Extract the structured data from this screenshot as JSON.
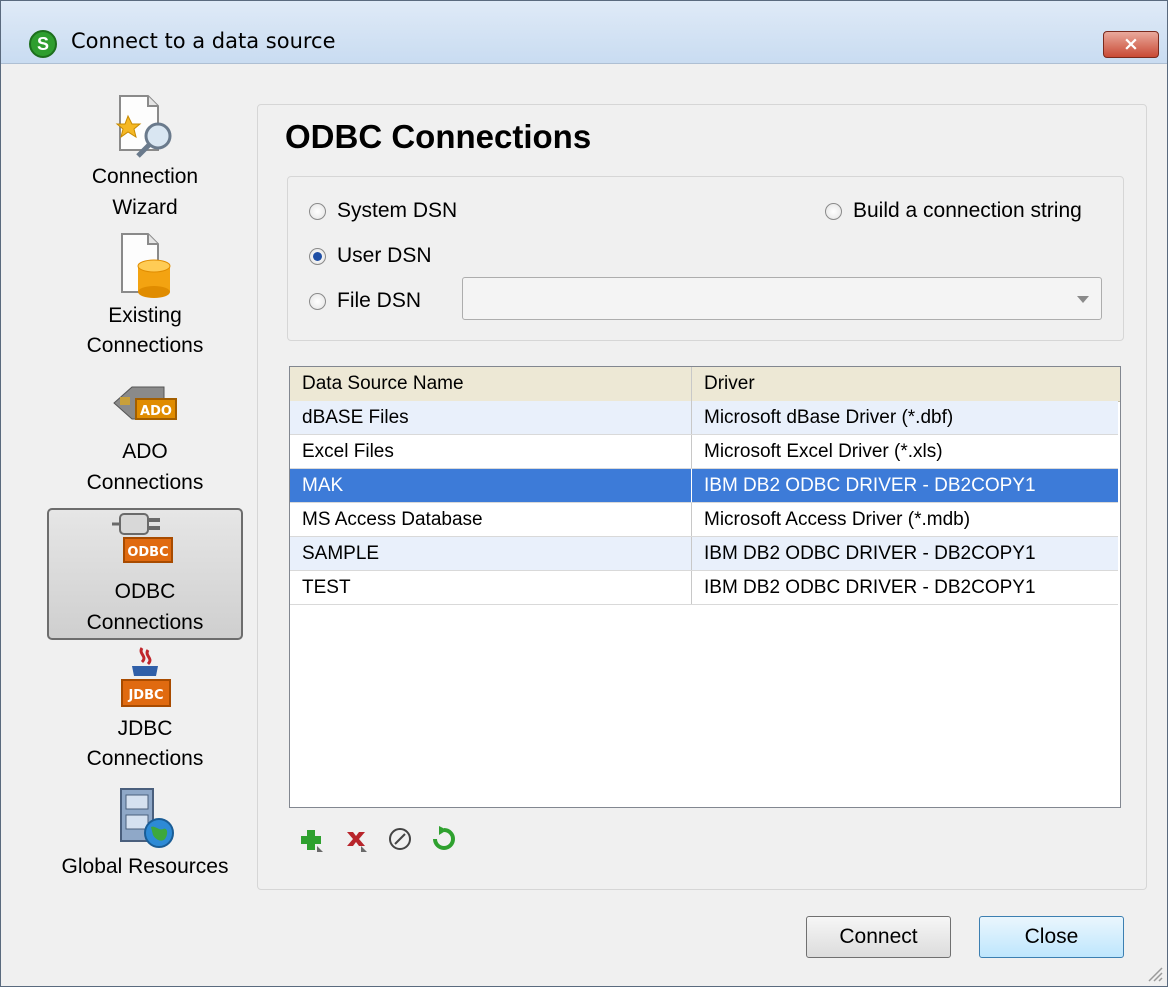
{
  "window": {
    "title": "Connect to a data source",
    "close_label": "×"
  },
  "sidebar": {
    "items": [
      {
        "label_line1": "Connection",
        "label_line2": "Wizard"
      },
      {
        "label_line1": "Existing",
        "label_line2": "Connections"
      },
      {
        "label_line1": "ADO",
        "label_line2": "Connections",
        "icon_text": "ADO"
      },
      {
        "label_line1": "ODBC",
        "label_line2": "Connections",
        "icon_text": "ODBC",
        "active": true
      },
      {
        "label_line1": "JDBC",
        "label_line2": "Connections",
        "icon_text": "JDBC"
      },
      {
        "label_line1": "Global Resources"
      }
    ]
  },
  "panel": {
    "title": "ODBC Connections",
    "radios": {
      "system_dsn": "System DSN",
      "user_dsn": "User DSN",
      "file_dsn": "File DSN",
      "build_string": "Build a connection string",
      "selected": "user_dsn"
    },
    "file_dsn_value": ""
  },
  "table": {
    "columns": [
      "Data Source Name",
      "Driver"
    ],
    "rows": [
      [
        "dBASE Files",
        "Microsoft dBase Driver (*.dbf)"
      ],
      [
        "Excel Files",
        "Microsoft Excel Driver (*.xls)"
      ],
      [
        "MAK",
        "IBM DB2 ODBC DRIVER - DB2COPY1"
      ],
      [
        "MS Access Database",
        "Microsoft Access Driver (*.mdb)"
      ],
      [
        "SAMPLE",
        "IBM DB2 ODBC DRIVER - DB2COPY1"
      ],
      [
        "TEST",
        "IBM DB2 ODBC DRIVER - DB2COPY1"
      ]
    ],
    "selected_row": 2
  },
  "toolbar": {
    "icons": [
      "add-icon",
      "delete-icon",
      "edit-icon",
      "refresh-icon"
    ]
  },
  "buttons": {
    "connect": "Connect",
    "close": "Close"
  },
  "colors": {
    "selection": "#3d7bd8",
    "accent": "#2f9e2f"
  }
}
